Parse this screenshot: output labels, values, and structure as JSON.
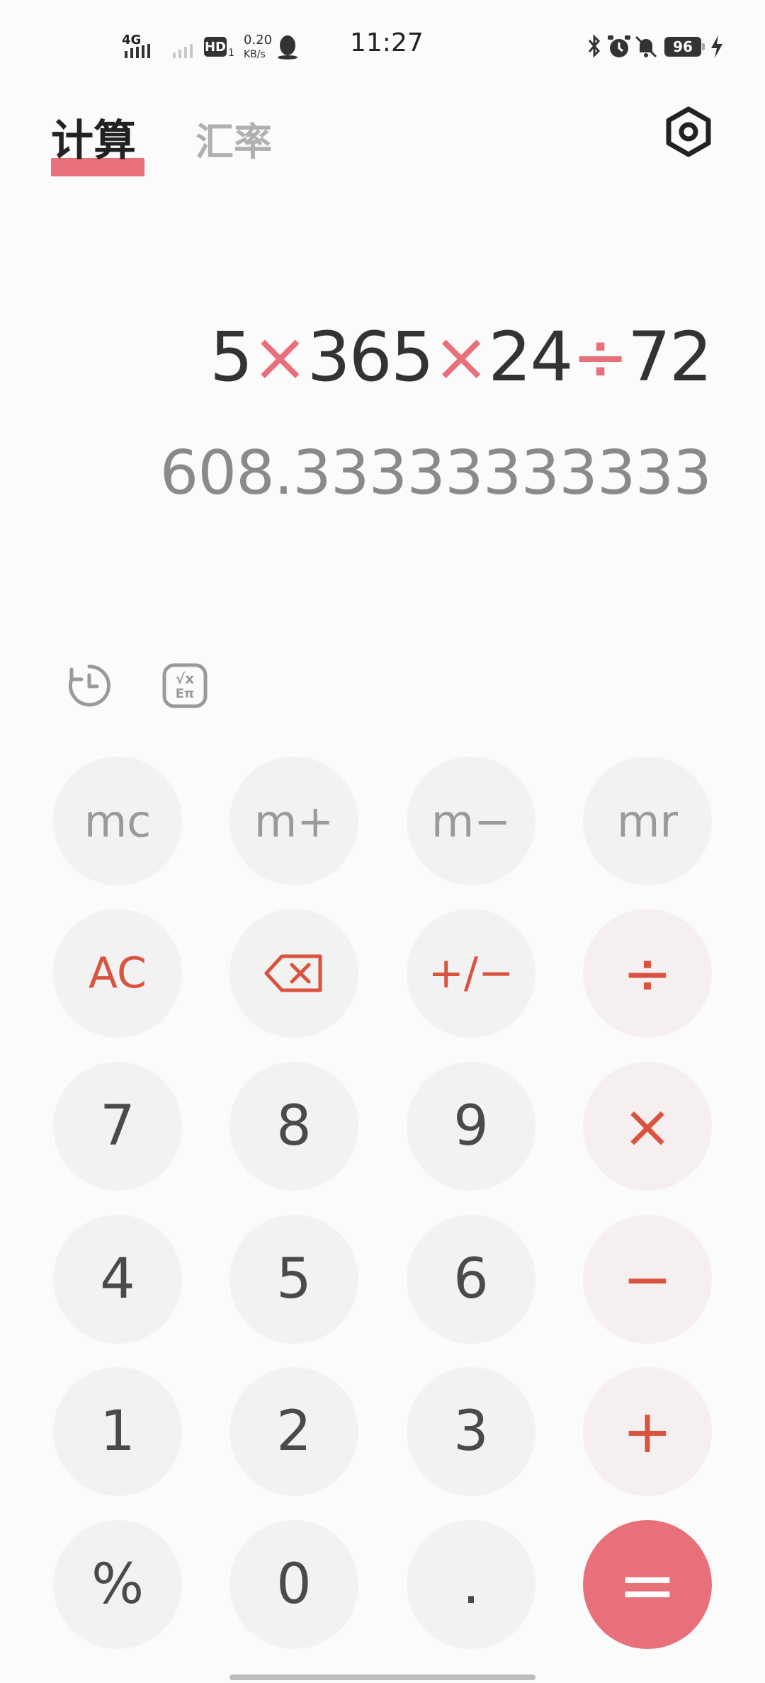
{
  "status_bar": {
    "network": "4G",
    "hd": "HD",
    "hd_sub": "1",
    "speed_value": "0.20",
    "speed_unit": "KB/s",
    "time": "11:27",
    "battery": "96"
  },
  "tabs": {
    "calc": "计算",
    "rate": "汇率"
  },
  "display": {
    "expression": [
      "5",
      "×",
      "365",
      "×",
      "24",
      "÷",
      "72"
    ],
    "result": "608.33333333333"
  },
  "keys": {
    "mc": "mc",
    "m_plus": "m+",
    "m_minus": "m−",
    "mr": "mr",
    "ac": "AC",
    "sign": "+/−",
    "divide": "÷",
    "k7": "7",
    "k8": "8",
    "k9": "9",
    "multiply": "×",
    "k4": "4",
    "k5": "5",
    "k6": "6",
    "minus": "−",
    "k1": "1",
    "k2": "2",
    "k3": "3",
    "plus": "+",
    "percent": "%",
    "k0": "0",
    "dot": ".",
    "equals": "="
  },
  "colors": {
    "accent": "#e8707a",
    "operator_text": "#d9533f",
    "key_bg": "#f2f2f2",
    "operator_bg": "#f6efef"
  }
}
